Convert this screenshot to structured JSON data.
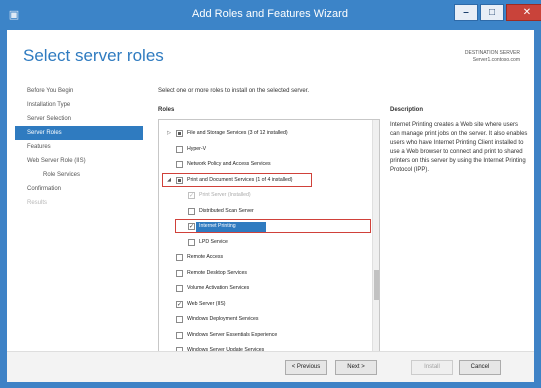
{
  "window": {
    "title": "Add Roles and Features Wizard",
    "controls": {
      "minimize": "–",
      "maximize": "□",
      "close": "✕"
    }
  },
  "page": {
    "title": "Select server roles",
    "destination_label": "DESTINATION SERVER",
    "destination_server": "Server1.contoso.com"
  },
  "nav": {
    "items": [
      {
        "label": "Before You Begin",
        "state": "normal",
        "sub": false
      },
      {
        "label": "Installation Type",
        "state": "normal",
        "sub": false
      },
      {
        "label": "Server Selection",
        "state": "normal",
        "sub": false
      },
      {
        "label": "Server Roles",
        "state": "active",
        "sub": false
      },
      {
        "label": "Features",
        "state": "normal",
        "sub": false
      },
      {
        "label": "Web Server Role (IIS)",
        "state": "normal",
        "sub": false
      },
      {
        "label": "Role Services",
        "state": "normal",
        "sub": true
      },
      {
        "label": "Confirmation",
        "state": "normal",
        "sub": false
      },
      {
        "label": "Results",
        "state": "disabled",
        "sub": false
      }
    ]
  },
  "main": {
    "instruction": "Select one or more roles to install on the selected server.",
    "roles_heading": "Roles",
    "description_heading": "Description",
    "description_text": "Internet Printing creates a Web site where users can manage print jobs on the server. It also enables users who have Internet Printing Client installed to use a Web browser to connect and print to shared printers on this server by using the Internet Printing Protocol (IPP)."
  },
  "roles": [
    {
      "label": "File and Storage Services (3 of 12 installed)",
      "indent": 0,
      "expander": "▷",
      "check": "partial",
      "dim": false
    },
    {
      "label": "Hyper-V",
      "indent": 0,
      "expander": "",
      "check": "none",
      "dim": false
    },
    {
      "label": "Network Policy and Access Services",
      "indent": 0,
      "expander": "",
      "check": "none",
      "dim": false
    },
    {
      "label": "Print and Document Services (1 of 4 installed)",
      "indent": 0,
      "expander": "◢",
      "check": "partial",
      "dim": false
    },
    {
      "label": "Print Server (Installed)",
      "indent": 1,
      "expander": "",
      "check": "checked",
      "dim": true
    },
    {
      "label": "Distributed Scan Server",
      "indent": 1,
      "expander": "",
      "check": "none",
      "dim": false
    },
    {
      "label": "Internet Printing",
      "indent": 1,
      "expander": "",
      "check": "checked",
      "dim": false
    },
    {
      "label": "LPD Service",
      "indent": 1,
      "expander": "",
      "check": "none",
      "dim": false
    },
    {
      "label": "Remote Access",
      "indent": 0,
      "expander": "",
      "check": "none",
      "dim": false
    },
    {
      "label": "Remote Desktop Services",
      "indent": 0,
      "expander": "",
      "check": "none",
      "dim": false
    },
    {
      "label": "Volume Activation Services",
      "indent": 0,
      "expander": "",
      "check": "none",
      "dim": false
    },
    {
      "label": "Web Server (IIS)",
      "indent": 0,
      "expander": "",
      "check": "checked",
      "dim": false
    },
    {
      "label": "Windows Deployment Services",
      "indent": 0,
      "expander": "",
      "check": "none",
      "dim": false
    },
    {
      "label": "Windows Server Essentials Experience",
      "indent": 0,
      "expander": "",
      "check": "none",
      "dim": false
    },
    {
      "label": "Windows Server Update Services",
      "indent": 0,
      "expander": "",
      "check": "none",
      "dim": false
    }
  ],
  "footer": {
    "previous": "< Previous",
    "next": "Next >",
    "install": "Install",
    "cancel": "Cancel"
  },
  "colors": {
    "title_bar": "#3c84c8",
    "accent": "#2f7bc0",
    "highlight_box": "#d0413a"
  }
}
